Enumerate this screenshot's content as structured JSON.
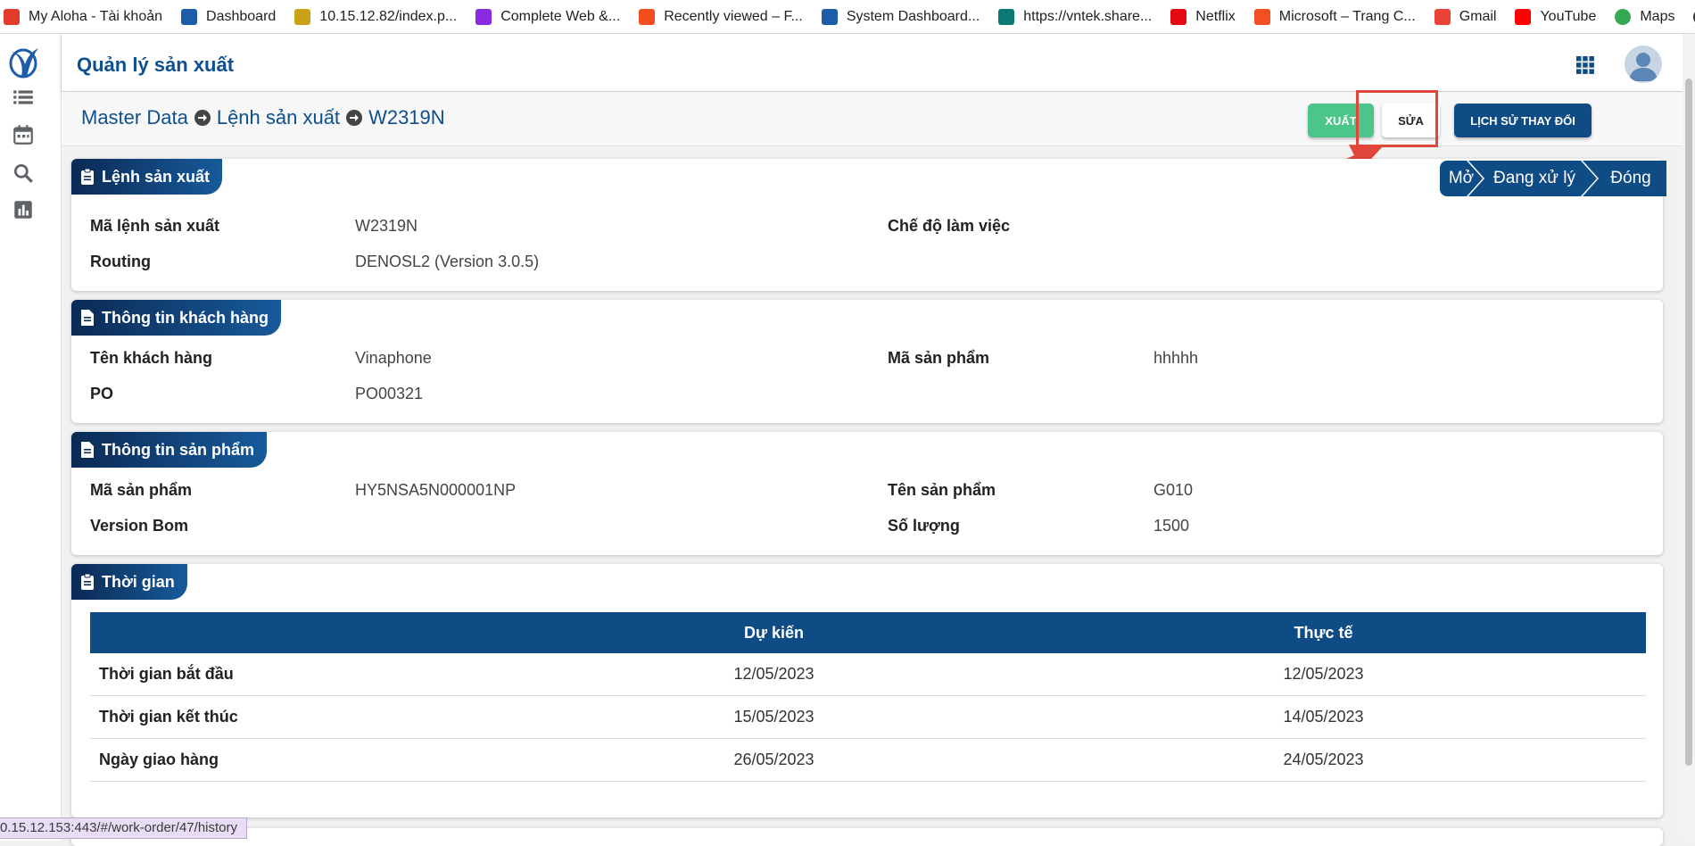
{
  "bookmarks": [
    {
      "label": "My Aloha - Tài khoản",
      "icon": "aloha-icon",
      "color": "#e23c2c"
    },
    {
      "label": "Dashboard",
      "icon": "vnpt-icon",
      "color": "#1c5ca8"
    },
    {
      "label": "10.15.12.82/index.p...",
      "icon": "site-icon",
      "color": "#c9a21a"
    },
    {
      "label": "Complete Web &...",
      "icon": "udemy-icon",
      "color": "#8a2be2"
    },
    {
      "label": "Recently viewed – F...",
      "icon": "figma-icon",
      "color": "#f24e1e"
    },
    {
      "label": "System Dashboard...",
      "icon": "jira-icon",
      "color": "#1c5ca8"
    },
    {
      "label": "https://vntek.share...",
      "icon": "sharepoint-icon",
      "color": "#0b7a75"
    },
    {
      "label": "Netflix",
      "icon": "netflix-icon",
      "color": "#e50914"
    },
    {
      "label": "Microsoft – Trang C...",
      "icon": "microsoft-icon",
      "color": "#f25022"
    },
    {
      "label": "Gmail",
      "icon": "gmail-icon",
      "color": "#ea4335"
    },
    {
      "label": "YouTube",
      "icon": "youtube-icon",
      "color": "#ff0000"
    },
    {
      "label": "Maps",
      "icon": "maps-icon",
      "color": "#34a853"
    },
    {
      "label": "",
      "icon": "globe-icon",
      "color": "#333333"
    }
  ],
  "app": {
    "title": "Quản lý sản xuất"
  },
  "breadcrumb": {
    "root": "Master Data",
    "section": "Lệnh sản xuất",
    "current": "W2319N"
  },
  "actions": {
    "export": "XUẤT",
    "edit": "SỬA",
    "history": "LỊCH SỬ THAY ĐỔI"
  },
  "status_steps": [
    "Mở",
    "Đang xử lý",
    "Đóng"
  ],
  "order": {
    "title": "Lệnh sản xuất",
    "code_label": "Mã lệnh sản xuất",
    "code_value": "W2319N",
    "routing_label": "Routing",
    "routing_value": "DENOSL2 (Version 3.0.5)",
    "mode_label": "Chế độ làm việc",
    "mode_value": ""
  },
  "customer": {
    "title": "Thông tin khách hàng",
    "name_label": "Tên khách hàng",
    "name_value": "Vinaphone",
    "product_code_label": "Mã sản phẩm",
    "product_code_value": "hhhhh",
    "po_label": "PO",
    "po_value": "PO00321"
  },
  "product": {
    "title": "Thông tin sản phẩm",
    "code_label": "Mã sản phẩm",
    "code_value": "HY5NSA5N000001NP",
    "name_label": "Tên sản phẩm",
    "name_value": "G010",
    "bom_label": "Version Bom",
    "bom_value": "",
    "qty_label": "Số lượng",
    "qty_value": "1500"
  },
  "time": {
    "title": "Thời gian",
    "headers": [
      "",
      "Dự kiến",
      "Thực tế"
    ],
    "rows": [
      {
        "label": "Thời gian bắt đầu",
        "planned": "12/05/2023",
        "actual": "12/05/2023"
      },
      {
        "label": "Thời gian kết thúc",
        "planned": "15/05/2023",
        "actual": "14/05/2023"
      },
      {
        "label": "Ngày giao hàng",
        "planned": "26/05/2023",
        "actual": "24/05/2023"
      }
    ]
  },
  "status_url": "0.15.12.153:443/#/work-order/47/history",
  "colors": {
    "primary": "#0f4c85",
    "export": "#4cc58b",
    "highlight": "#e2453c"
  }
}
